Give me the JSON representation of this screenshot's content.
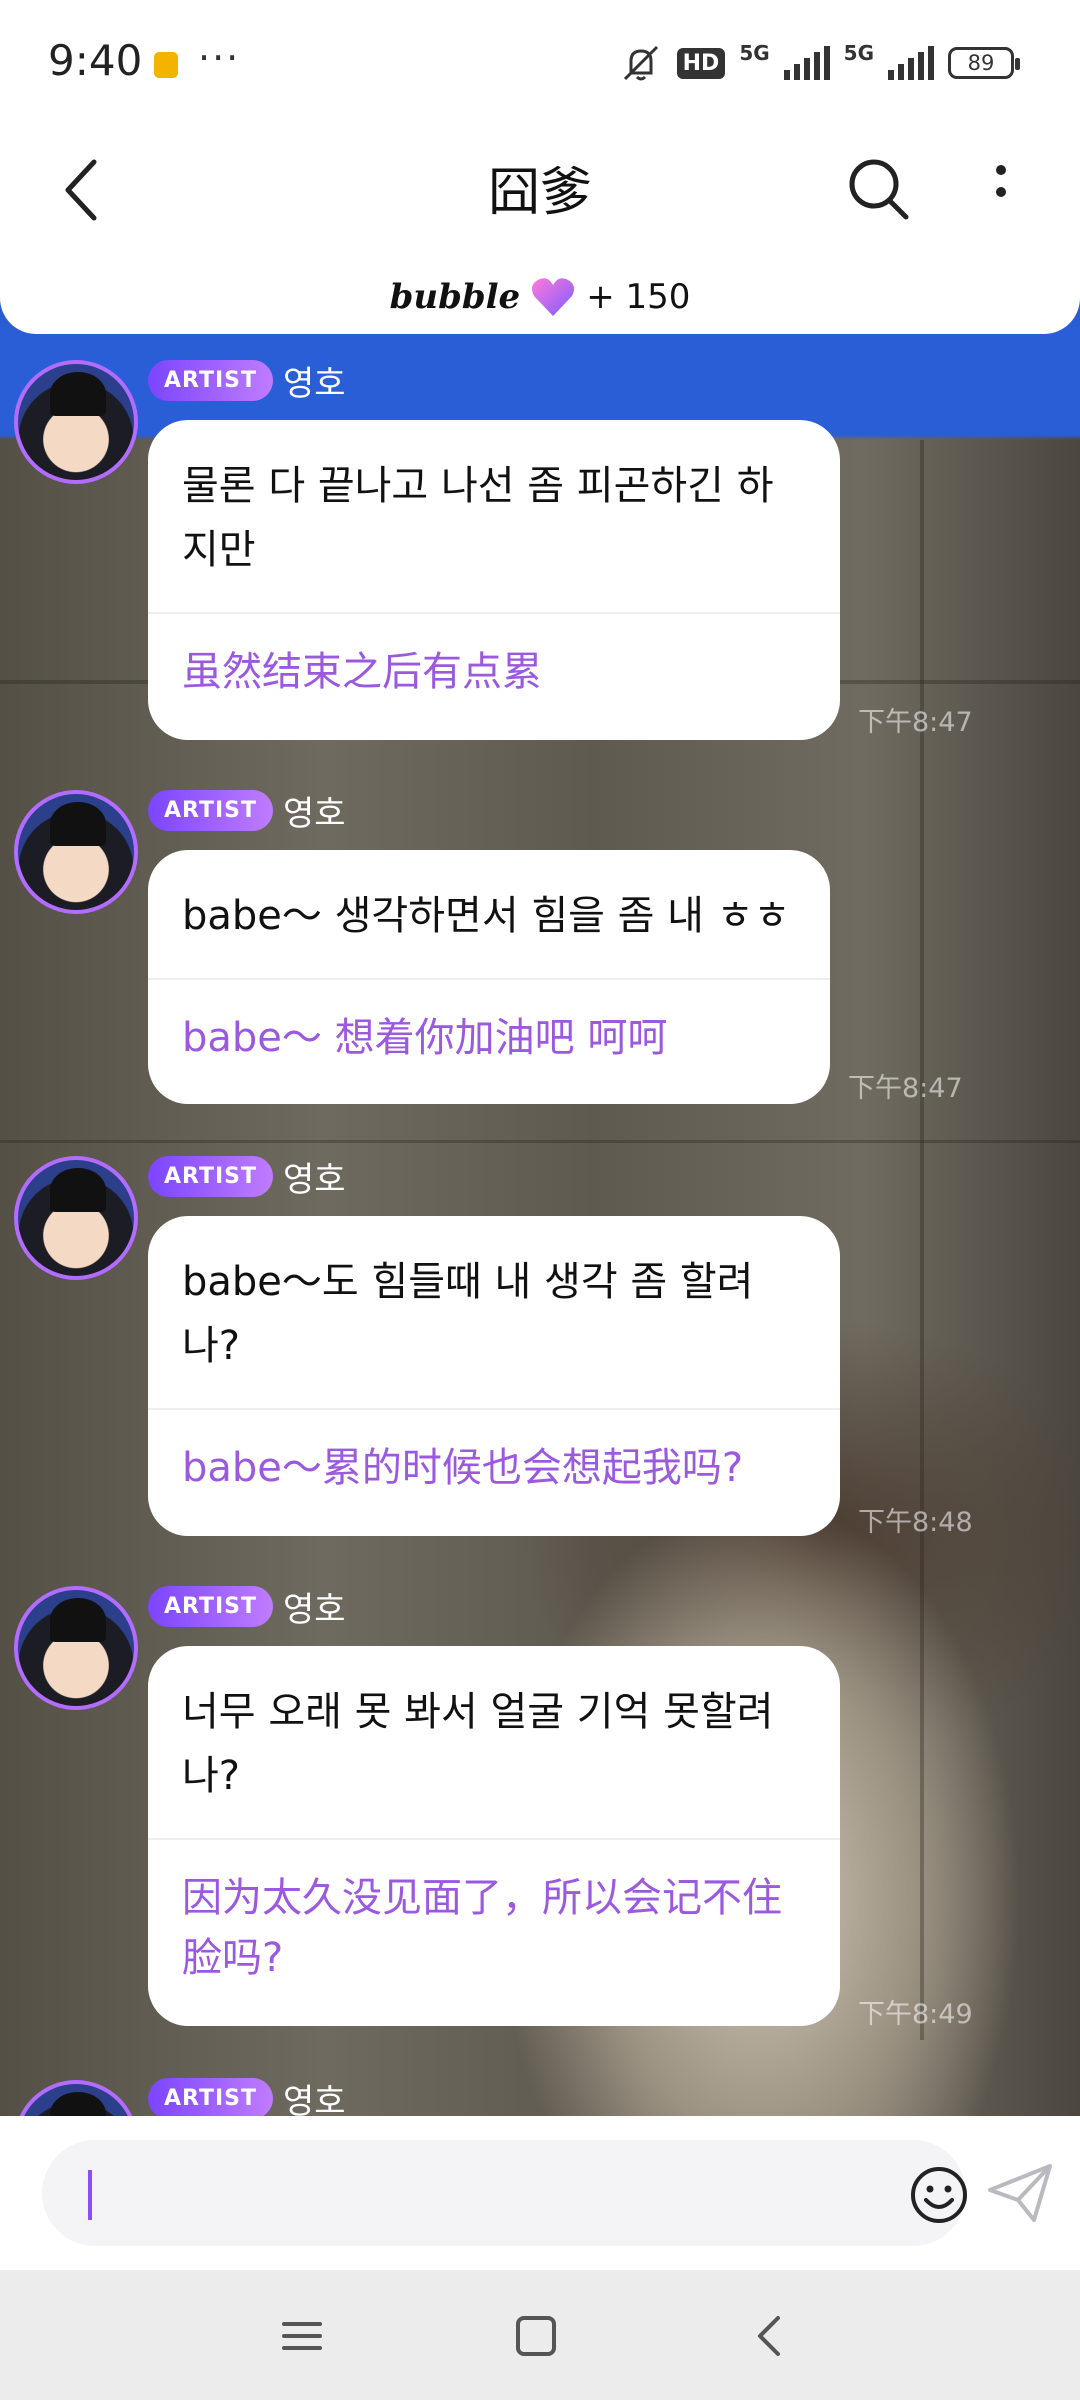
{
  "status_bar": {
    "time": "9:40",
    "dots": "···",
    "hd_label": "HD",
    "network_1": "5G",
    "network_2": "5G",
    "battery": "89"
  },
  "header": {
    "title": "囧爹"
  },
  "banner": {
    "logo": "bubble",
    "count": "+ 150"
  },
  "messages": [
    {
      "badge": "ARTIST",
      "sender": "영호",
      "korean": "물론 다 끝나고 나선 좀 피곤하긴 하지만",
      "chinese": "虽然结束之后有点累",
      "time": "下午8:47"
    },
    {
      "badge": "ARTIST",
      "sender": "영호",
      "korean": "babe～ 생각하면서 힘을 좀 내 ㅎㅎ",
      "chinese": "babe～ 想着你加油吧 呵呵",
      "time": "下午8:47"
    },
    {
      "badge": "ARTIST",
      "sender": "영호",
      "korean": "babe～도 힘들때 내 생각 좀 할려나?",
      "chinese": "babe～累的时候也会想起我吗?",
      "time": "下午8:48"
    },
    {
      "badge": "ARTIST",
      "sender": "영호",
      "korean": "너무 오래 못 봐서 얼굴 기억 못할려나?",
      "chinese": "因为太久没见面了，所以会记不住脸吗?",
      "time": "下午8:49"
    },
    {
      "badge": "ARTIST",
      "sender": "영호"
    }
  ],
  "colors": {
    "accent_purple": "#9b59e0",
    "badge_gradient_start": "#7b45ff",
    "badge_gradient_end": "#c07cff",
    "top_blue": "#2a5ed6"
  }
}
